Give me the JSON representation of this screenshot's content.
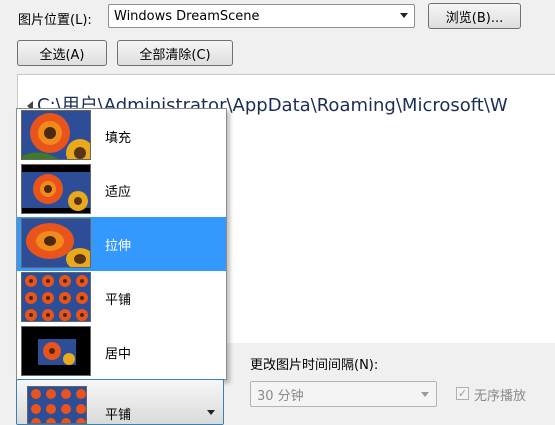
{
  "top": {
    "location_label": "图片位置(L):",
    "location_value": "Windows DreamScene",
    "browse_label": "浏览(B)...",
    "select_all_label": "全选(A)",
    "clear_all_label": "全部清除(C)"
  },
  "pane": {
    "path": "C:\\用户\\Administrator\\AppData\\Roaming\\Microsoft\\W"
  },
  "position_options": [
    {
      "label": "填充",
      "selected": false
    },
    {
      "label": "适应",
      "selected": false
    },
    {
      "label": "拉伸",
      "selected": true
    },
    {
      "label": "平铺",
      "selected": false
    },
    {
      "label": "居中",
      "selected": false
    }
  ],
  "position_select": {
    "value": "平铺"
  },
  "interval": {
    "label": "更改图片时间间隔(N):",
    "value": "30 分钟"
  },
  "shuffle": {
    "label": "无序播放",
    "checked": true,
    "check_glyph": "✓"
  },
  "colors": {
    "selection": "#3399ff",
    "path_text": "#1b2f52"
  }
}
